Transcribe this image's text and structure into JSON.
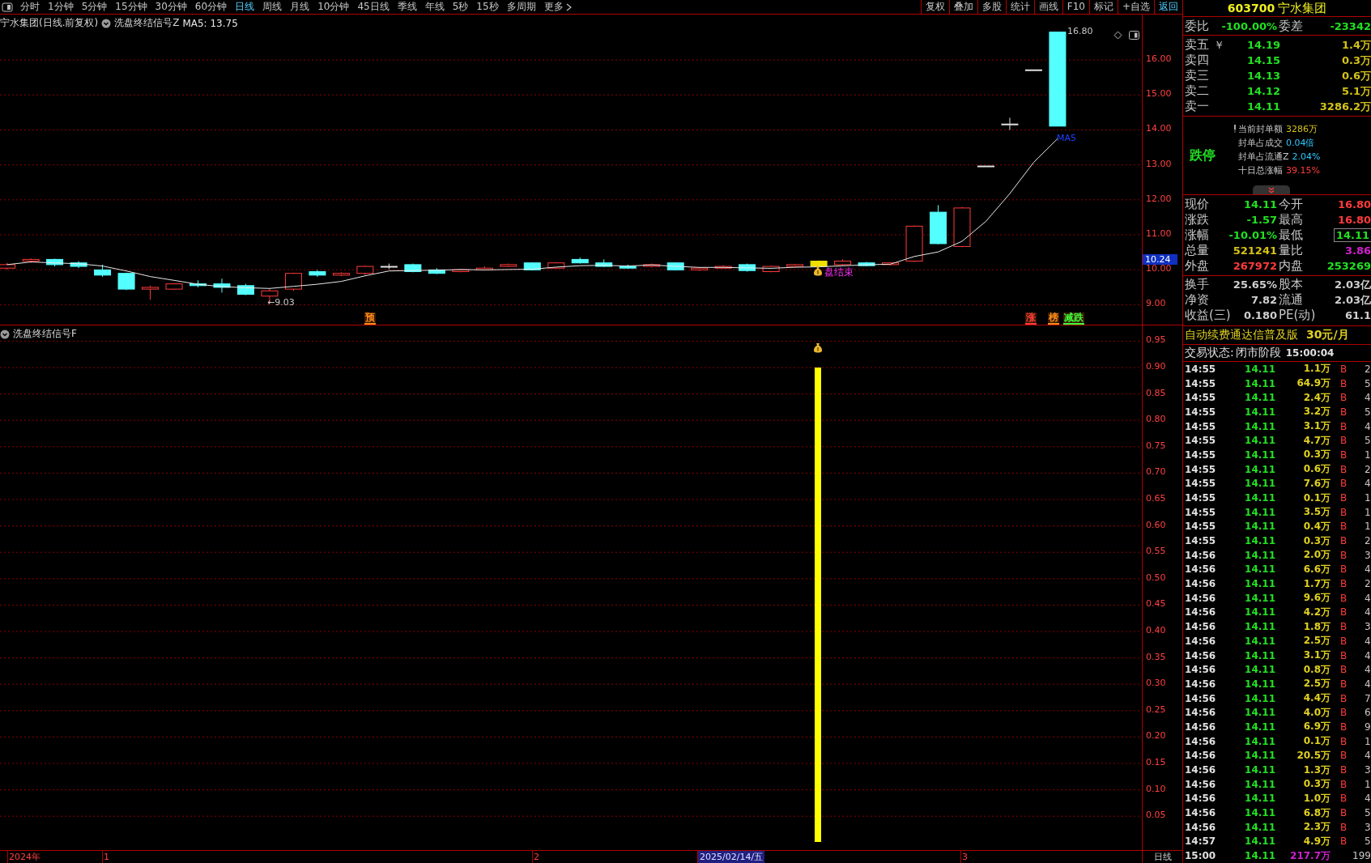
{
  "toolbar": {
    "periods": [
      {
        "label": "分时",
        "selected": false
      },
      {
        "label": "1分钟",
        "selected": false
      },
      {
        "label": "5分钟",
        "selected": false
      },
      {
        "label": "15分钟",
        "selected": false
      },
      {
        "label": "30分钟",
        "selected": false
      },
      {
        "label": "60分钟",
        "selected": false
      },
      {
        "label": "日线",
        "selected": true
      },
      {
        "label": "周线",
        "selected": false
      },
      {
        "label": "月线",
        "selected": false
      },
      {
        "label": "10分钟",
        "selected": false
      },
      {
        "label": "45日线",
        "selected": false
      },
      {
        "label": "季线",
        "selected": false
      },
      {
        "label": "年线",
        "selected": false
      },
      {
        "label": "5秒",
        "selected": false
      },
      {
        "label": "15秒",
        "selected": false
      },
      {
        "label": "多周期",
        "selected": false
      },
      {
        "label": "更多",
        "selected": false
      }
    ],
    "tools": [
      {
        "label": "复权",
        "active": false
      },
      {
        "label": "叠加",
        "active": false
      },
      {
        "label": "多股",
        "active": false
      },
      {
        "label": "统计",
        "active": false
      },
      {
        "label": "画线",
        "active": false
      },
      {
        "label": "F10",
        "active": false
      },
      {
        "label": "标记",
        "active": false
      },
      {
        "label": "+自选",
        "active": false
      },
      {
        "label": "返回",
        "active": true
      }
    ]
  },
  "chart_header": {
    "title": "宁水集团(日线.前复权)",
    "indicator": "洗盘终结信号Z",
    "ma": "MA5: 13.75"
  },
  "price_axis": [
    "16.00",
    "15.00",
    "14.00",
    "13.00",
    "12.00",
    "11.00",
    "10.00",
    "9.00"
  ],
  "current_price_tag": "10.24",
  "annotations": {
    "high": "16.80",
    "low": "←9.03",
    "ma_label": "MA5",
    "signal": "盘结束"
  },
  "markers": [
    {
      "text": "预",
      "color": "#ff8c1a"
    },
    {
      "text": "涨",
      "color": "#ff3b3b"
    },
    {
      "text": "榜",
      "color": "#ff8c1a"
    },
    {
      "text": "减跌",
      "color": "#3bff3b"
    }
  ],
  "indicator_panel": {
    "title": "洗盘终结信号F",
    "axis": [
      "0.95",
      "0.90",
      "0.85",
      "0.80",
      "0.75",
      "0.70",
      "0.65",
      "0.60",
      "0.55",
      "0.50",
      "0.45",
      "0.40",
      "0.35",
      "0.30",
      "0.25",
      "0.20",
      "0.15",
      "0.10",
      "0.05"
    ]
  },
  "time_axis": [
    {
      "label": "2024年",
      "selected": false
    },
    {
      "label": "1",
      "selected": false
    },
    {
      "label": "2",
      "selected": false
    },
    {
      "label": "2025/02/14/五",
      "selected": true
    },
    {
      "label": "3",
      "selected": false
    }
  ],
  "period_label": "日线",
  "quote": {
    "code": "603700",
    "name": "宁水集团",
    "ratio": {
      "label": "委比",
      "value": "-100.00%",
      "label2": "委差",
      "value2": "-23342"
    },
    "currency_icon": "￥",
    "sells": [
      {
        "label": "卖五",
        "price": "14.19",
        "volume": "1.4万"
      },
      {
        "label": "卖四",
        "price": "14.15",
        "volume": "0.3万"
      },
      {
        "label": "卖三",
        "price": "14.13",
        "volume": "0.6万"
      },
      {
        "label": "卖二",
        "price": "14.12",
        "volume": "5.1万"
      },
      {
        "label": "卖一",
        "price": "14.11",
        "volume": "3286.2万"
      }
    ],
    "limit_status": "跌停",
    "limit_info": [
      {
        "label": "当前封单额",
        "value": "3286万",
        "color": "#d4c21a"
      },
      {
        "label": "封单占成交",
        "value": "0.04倍",
        "color": "#2ec8ff"
      },
      {
        "label": "封单占流通Z",
        "value": "2.04%",
        "color": "#2ec8ff"
      },
      {
        "label": "十日总涨幅",
        "value": "39.15%",
        "color": "#ff3b3b"
      }
    ],
    "stats": [
      {
        "label": "现价",
        "value": "14.11",
        "color": "#22e022",
        "boxed": false
      },
      {
        "label": "今开",
        "value": "16.80",
        "color": "#ff3b3b",
        "boxed": false
      },
      {
        "label": "涨跌",
        "value": "-1.57",
        "color": "#22e022",
        "boxed": false
      },
      {
        "label": "最高",
        "value": "16.80",
        "color": "#ff3b3b",
        "boxed": false
      },
      {
        "label": "涨幅",
        "value": "-10.01%",
        "color": "#22e022",
        "boxed": false
      },
      {
        "label": "最低",
        "value": "14.11",
        "color": "#22e022",
        "boxed": true
      },
      {
        "label": "总量",
        "value": "521241",
        "color": "#d4c21a",
        "boxed": false
      },
      {
        "label": "量比",
        "value": "3.86",
        "color": "#d020d0",
        "boxed": false
      },
      {
        "label": "外盘",
        "value": "267972",
        "color": "#ff3b3b",
        "boxed": false
      },
      {
        "label": "内盘",
        "value": "253269",
        "color": "#22e022",
        "boxed": false
      }
    ],
    "fundamentals": [
      {
        "label": "换手",
        "value": "25.65%"
      },
      {
        "label": "股本",
        "value": "2.03亿"
      },
      {
        "label": "净资",
        "value": "7.82"
      },
      {
        "label": "流通",
        "value": "2.03亿"
      },
      {
        "label": "收益(三)",
        "value": "0.180"
      },
      {
        "label": "PE(动)",
        "value": "61.1"
      }
    ],
    "promo": {
      "text": "自动续费通达信普及版",
      "price": "30元/月"
    },
    "trade_status": {
      "label": "交易状态:",
      "value": "闭市阶段",
      "time": "15:00:04"
    }
  },
  "ticks": [
    {
      "kind": "trade",
      "time": "14:55",
      "price": "14.11",
      "volume": "1.1万",
      "side": "B",
      "count": "2"
    },
    {
      "kind": "trade",
      "time": "14:55",
      "price": "14.11",
      "volume": "64.9万",
      "side": "B",
      "count": "5"
    },
    {
      "kind": "trade",
      "time": "14:55",
      "price": "14.11",
      "volume": "2.4万",
      "side": "B",
      "count": "4"
    },
    {
      "kind": "trade",
      "time": "14:55",
      "price": "14.11",
      "volume": "3.2万",
      "side": "B",
      "count": "5"
    },
    {
      "kind": "trade",
      "time": "14:55",
      "price": "14.11",
      "volume": "3.1万",
      "side": "B",
      "count": "4"
    },
    {
      "kind": "trade",
      "time": "14:55",
      "price": "14.11",
      "volume": "4.7万",
      "side": "B",
      "count": "5"
    },
    {
      "kind": "trade",
      "time": "14:55",
      "price": "14.11",
      "volume": "0.3万",
      "side": "B",
      "count": "1"
    },
    {
      "kind": "trade",
      "time": "14:55",
      "price": "14.11",
      "volume": "0.6万",
      "side": "B",
      "count": "2"
    },
    {
      "kind": "trade",
      "time": "14:55",
      "price": "14.11",
      "volume": "7.6万",
      "side": "B",
      "count": "4"
    },
    {
      "kind": "trade",
      "time": "14:55",
      "price": "14.11",
      "volume": "0.1万",
      "side": "B",
      "count": "1"
    },
    {
      "kind": "trade",
      "time": "14:55",
      "price": "14.11",
      "volume": "3.5万",
      "side": "B",
      "count": "1"
    },
    {
      "kind": "trade",
      "time": "14:55",
      "price": "14.11",
      "volume": "0.4万",
      "side": "B",
      "count": "1"
    },
    {
      "kind": "trade",
      "time": "14:55",
      "price": "14.11",
      "volume": "0.3万",
      "side": "B",
      "count": "2"
    },
    {
      "kind": "trade",
      "time": "14:56",
      "price": "14.11",
      "volume": "2.0万",
      "side": "B",
      "count": "3"
    },
    {
      "kind": "trade",
      "time": "14:56",
      "price": "14.11",
      "volume": "6.6万",
      "side": "B",
      "count": "4"
    },
    {
      "kind": "trade",
      "time": "14:56",
      "price": "14.11",
      "volume": "1.7万",
      "side": "B",
      "count": "2"
    },
    {
      "kind": "trade",
      "time": "14:56",
      "price": "14.11",
      "volume": "9.6万",
      "side": "B",
      "count": "4"
    },
    {
      "kind": "trade",
      "time": "14:56",
      "price": "14.11",
      "volume": "4.2万",
      "side": "B",
      "count": "4"
    },
    {
      "kind": "trade",
      "time": "14:56",
      "price": "14.11",
      "volume": "1.8万",
      "side": "B",
      "count": "3"
    },
    {
      "kind": "trade",
      "time": "14:56",
      "price": "14.11",
      "volume": "2.5万",
      "side": "B",
      "count": "4"
    },
    {
      "kind": "trade",
      "time": "14:56",
      "price": "14.11",
      "volume": "3.1万",
      "side": "B",
      "count": "4"
    },
    {
      "kind": "trade",
      "time": "14:56",
      "price": "14.11",
      "volume": "0.8万",
      "side": "B",
      "count": "4"
    },
    {
      "kind": "trade",
      "time": "14:56",
      "price": "14.11",
      "volume": "2.5万",
      "side": "B",
      "count": "4"
    },
    {
      "kind": "trade",
      "time": "14:56",
      "price": "14.11",
      "volume": "4.4万",
      "side": "B",
      "count": "7"
    },
    {
      "kind": "trade",
      "time": "14:56",
      "price": "14.11",
      "volume": "4.0万",
      "side": "B",
      "count": "6"
    },
    {
      "kind": "trade",
      "time": "14:56",
      "price": "14.11",
      "volume": "6.9万",
      "side": "B",
      "count": "9"
    },
    {
      "kind": "trade",
      "time": "14:56",
      "price": "14.11",
      "volume": "0.1万",
      "side": "B",
      "count": "1"
    },
    {
      "kind": "trade",
      "time": "14:56",
      "price": "14.11",
      "volume": "20.5万",
      "side": "B",
      "count": "4"
    },
    {
      "kind": "trade",
      "time": "14:56",
      "price": "14.11",
      "volume": "1.3万",
      "side": "B",
      "count": "3"
    },
    {
      "kind": "trade",
      "time": "14:56",
      "price": "14.11",
      "volume": "0.3万",
      "side": "B",
      "count": "1"
    },
    {
      "kind": "trade",
      "time": "14:56",
      "price": "14.11",
      "volume": "1.0万",
      "side": "B",
      "count": "4"
    },
    {
      "kind": "trade",
      "time": "14:56",
      "price": "14.11",
      "volume": "6.8万",
      "side": "B",
      "count": "5"
    },
    {
      "kind": "trade",
      "time": "14:56",
      "price": "14.11",
      "volume": "2.3万",
      "side": "B",
      "count": "3"
    },
    {
      "kind": "trade",
      "time": "14:57",
      "price": "14.11",
      "volume": "4.9万",
      "side": "B",
      "count": "5"
    },
    {
      "kind": "total",
      "time": "15:00",
      "price": "14.11",
      "volume": "217.7万",
      "count": "199"
    }
  ]
}
